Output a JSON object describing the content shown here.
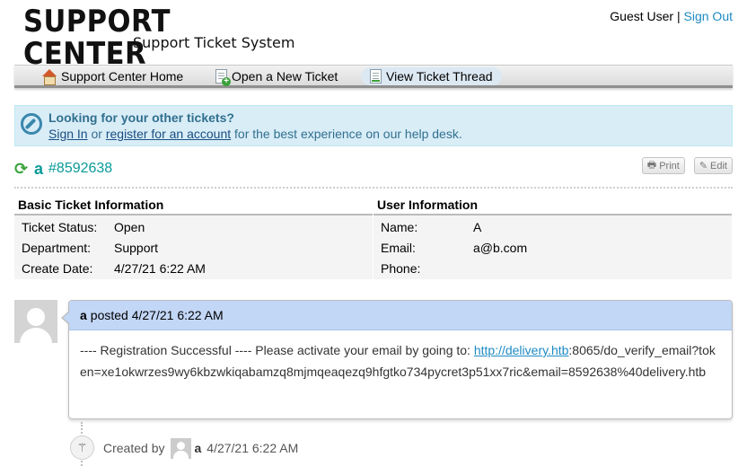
{
  "header": {
    "logo_title": "SUPPORT CENTER",
    "logo_subtitle": "Support Ticket System",
    "guest_label": "Guest User",
    "separator": "|",
    "sign_out": "Sign Out"
  },
  "nav": {
    "items": [
      {
        "label": "Support Center Home",
        "icon": "home-icon"
      },
      {
        "label": "Open a New Ticket",
        "icon": "new-ticket-icon"
      },
      {
        "label": "View Ticket Thread",
        "icon": "ticket-thread-icon",
        "active": true
      }
    ]
  },
  "banner": {
    "title": "Looking for your other tickets?",
    "sign_in": "Sign In",
    "or": " or ",
    "register": "register for an account",
    "suffix": " for the best experience on our help desk.",
    "icon": "compass-icon"
  },
  "ticket": {
    "subject": "a",
    "number": "#8592638",
    "print_label": "Print",
    "edit_label": "Edit"
  },
  "basic_info": {
    "heading": "Basic Ticket Information",
    "rows": [
      {
        "label": "Ticket Status:",
        "value": "Open"
      },
      {
        "label": "Department:",
        "value": "Support"
      },
      {
        "label": "Create Date:",
        "value": "4/27/21 6:22 AM"
      }
    ]
  },
  "user_info": {
    "heading": "User Information",
    "rows": [
      {
        "label": "Name:",
        "value": "A"
      },
      {
        "label": "Email:",
        "value": "a@b.com"
      },
      {
        "label": "Phone:",
        "value": ""
      }
    ]
  },
  "thread": {
    "entry": {
      "author": "a",
      "posted_text": "posted 4/27/21 6:22 AM",
      "body_prefix": "---- Registration Successful ---- Please activate your email by going to: ",
      "link_text": "http://delivery.htb",
      "body_suffix": ":8065/do_verify_email?token=xe1okwrzes9wy6kbzwkiqabamzq8mjmqeaqezq9hfgtko734pycret3p51xx7ric&email=8592638%40delivery.htb"
    },
    "event": {
      "created_by": "Created by",
      "author": "a",
      "time": "4/27/21 6:22 AM"
    }
  },
  "colors": {
    "banner_bg": "#d9edf7",
    "banner_text": "#31708f",
    "entry_head": "#c2d6f6",
    "ticket_title": "#0a9a9a",
    "link": "#1e8bc3"
  }
}
